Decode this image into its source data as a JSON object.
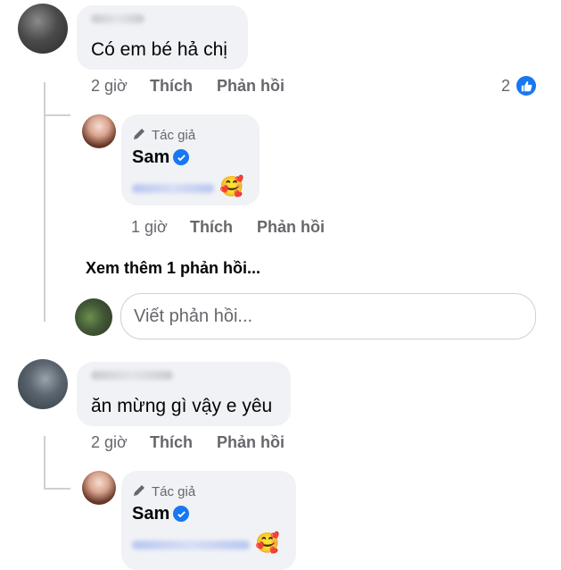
{
  "comments": [
    {
      "text": "Có em bé hả chị",
      "time": "2 giờ",
      "like_label": "Thích",
      "reply_label": "Phản hồi",
      "reaction_count": "2",
      "author_reply": {
        "tag": "Tác giả",
        "name": "Sam",
        "emoji": "🥰",
        "time": "1 giờ",
        "like_label": "Thích",
        "reply_label": "Phản hồi"
      },
      "more_replies": "Xem thêm 1 phản hồi...",
      "reply_placeholder": "Viết phản hồi..."
    },
    {
      "text": "ăn mừng gì vậy e yêu",
      "time": "2 giờ",
      "like_label": "Thích",
      "reply_label": "Phản hồi",
      "author_reply": {
        "tag": "Tác giả",
        "name": "Sam",
        "emoji": "🥰"
      }
    }
  ],
  "colors": {
    "bubble": "#f0f2f5",
    "meta_text": "#65676b",
    "accent_blue": "#1877f2"
  }
}
